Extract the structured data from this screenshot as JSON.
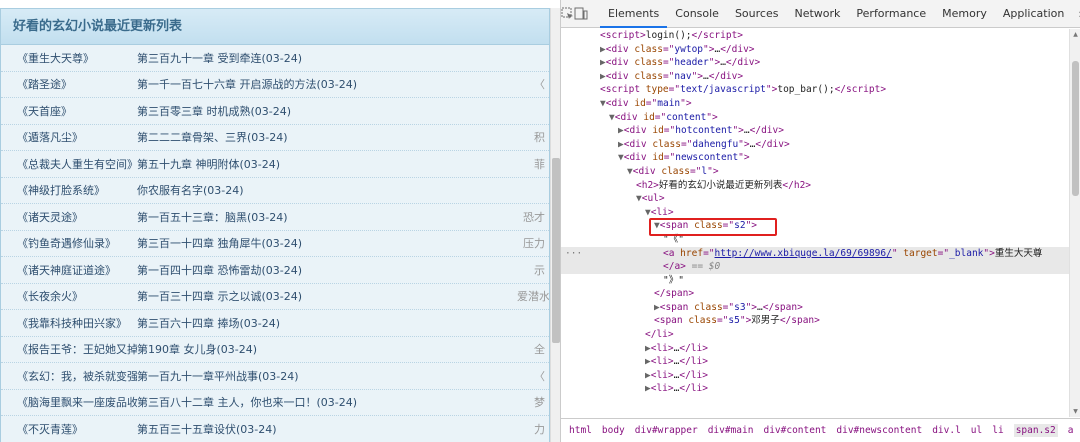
{
  "page": {
    "heading": "好看的玄幻小说最近更新列表",
    "rows": [
      {
        "title": "《重生大天尊》",
        "chapter": "第三百九十一章 受到牵连(03-24)",
        "author": ""
      },
      {
        "title": "《踏圣途》",
        "chapter": "第一千一百七十六章 开启源战的方法(03-24)",
        "author": "〈"
      },
      {
        "title": "《天首座》",
        "chapter": "第三百零三章 时机成熟(03-24)",
        "author": ""
      },
      {
        "title": "《遁落凡尘》",
        "chapter": "第二二二章骨架、三界(03-24)",
        "author": "积"
      },
      {
        "title": "《总裁夫人重生有空间》",
        "chapter": "第五十九章 神明附体(03-24)",
        "author": "菲"
      },
      {
        "title": "《神级打脸系统》",
        "chapter": "你农服有名字(03-24)",
        "author": ""
      },
      {
        "title": "《诸天灵途》",
        "chapter": "第一百五十三章：脑黑(03-24)",
        "author": "恐才"
      },
      {
        "title": "《钓鱼奇遇修仙录》",
        "chapter": "第三百一十四章 独角犀牛(03-24)",
        "author": "压力"
      },
      {
        "title": "《诸天神庭证道途》",
        "chapter": "第一百四十四章 恐怖雷劫(03-24)",
        "author": "示"
      },
      {
        "title": "《长夜余火》",
        "chapter": "第一百三十四章 示之以诚(03-24)",
        "author": "爱潜水"
      },
      {
        "title": "《我靠科技种田兴家》",
        "chapter": "第三百六十四章 捧场(03-24)",
        "author": ""
      },
      {
        "title": "《报告王爷：王妃她又掉马",
        "chapter": "第190章 女儿身(03-24)",
        "author": "全"
      },
      {
        "title": "《玄幻：我，被杀就变强！》",
        "chapter": "第一百九十一章平州战事(03-24)",
        "author": "〈"
      },
      {
        "title": "《脑海里飘来一座废品收购",
        "chapter": "第三百八十二章 主人，你也来一口！(03-24)",
        "author": "梦"
      },
      {
        "title": "《不灭青莲》",
        "chapter": "第五百三十五章设伏(03-24)",
        "author": "力"
      }
    ]
  },
  "devtools": {
    "tabs": [
      "Elements",
      "Console",
      "Sources",
      "Network",
      "Performance",
      "Memory",
      "Application"
    ],
    "more": "»",
    "lines": [
      {
        "indent": 1,
        "html": "<span class='tag'>&lt;script&gt;</span><span class='txt'>login();</span><span class='tag'>&lt;/script&gt;</span>"
      },
      {
        "indent": 1,
        "html": "<span class='tri'>▶</span><span class='tag'>&lt;div </span><span class='attr'>class</span><span class='tag'>=\"</span><span class='val'>ywtop</span><span class='tag'>\"&gt;</span><span class='txt'>…</span><span class='tag'>&lt;/div&gt;</span>"
      },
      {
        "indent": 1,
        "html": "<span class='tri'>▶</span><span class='tag'>&lt;div </span><span class='attr'>class</span><span class='tag'>=\"</span><span class='val'>header</span><span class='tag'>\"&gt;</span><span class='txt'>…</span><span class='tag'>&lt;/div&gt;</span>"
      },
      {
        "indent": 1,
        "html": "<span class='tri'>▶</span><span class='tag'>&lt;div </span><span class='attr'>class</span><span class='tag'>=\"</span><span class='val'>nav</span><span class='tag'>\"&gt;</span><span class='txt'>…</span><span class='tag'>&lt;/div&gt;</span>"
      },
      {
        "indent": 1,
        "html": "<span class='tag'>&lt;script </span><span class='attr'>type</span><span class='tag'>=\"</span><span class='val'>text/javascript</span><span class='tag'>\"&gt;</span><span class='txt'>top_bar();</span><span class='tag'>&lt;/script&gt;</span>"
      },
      {
        "indent": 1,
        "html": "<span class='tri'>▼</span><span class='tag'>&lt;div </span><span class='attr'>id</span><span class='tag'>=\"</span><span class='val'>main</span><span class='tag'>\"&gt;</span>"
      },
      {
        "indent": 2,
        "html": "<span class='tri'>▼</span><span class='tag'>&lt;div </span><span class='attr'>id</span><span class='tag'>=\"</span><span class='val'>content</span><span class='tag'>\"&gt;</span>"
      },
      {
        "indent": 3,
        "html": "<span class='tri'>▶</span><span class='tag'>&lt;div </span><span class='attr'>id</span><span class='tag'>=\"</span><span class='val'>hotcontent</span><span class='tag'>\"&gt;</span><span class='txt'>…</span><span class='tag'>&lt;/div&gt;</span>"
      },
      {
        "indent": 3,
        "html": "<span class='tri'>▶</span><span class='tag'>&lt;div </span><span class='attr'>class</span><span class='tag'>=\"</span><span class='val'>dahengfu</span><span class='tag'>\"&gt;</span><span class='txt'>…</span><span class='tag'>&lt;/div&gt;</span>"
      },
      {
        "indent": 3,
        "html": "<span class='tri'>▼</span><span class='tag'>&lt;div </span><span class='attr'>id</span><span class='tag'>=\"</span><span class='val'>newscontent</span><span class='tag'>\"&gt;</span>"
      },
      {
        "indent": 4,
        "html": "<span class='tri'>▼</span><span class='tag'>&lt;div </span><span class='attr'>class</span><span class='tag'>=\"</span><span class='val'>l</span><span class='tag'>\"&gt;</span>"
      },
      {
        "indent": 5,
        "html": "<span class='tag'>&lt;h2&gt;</span><span class='txt'>好看的玄幻小说最近更新列表</span><span class='tag'>&lt;/h2&gt;</span>"
      },
      {
        "indent": 5,
        "html": "<span class='tri'>▼</span><span class='tag'>&lt;ul&gt;</span>"
      },
      {
        "indent": 6,
        "html": "<span class='tri'>▼</span><span class='tag'>&lt;li&gt;</span>"
      },
      {
        "indent": 7,
        "html": "<span class='tri'>▼</span><span class='tag'>&lt;span </span><span class='attr'>class</span><span class='tag'>=\"</span><span class='val'>s2</span><span class='tag'>\"&gt;</span>"
      },
      {
        "indent": 8,
        "html": "<span class='txt'>\"《\"</span>"
      },
      {
        "indent": 8,
        "selected": true,
        "html": "<span class='tag'>&lt;a </span><span class='attr'>href</span><span class='tag'>=\"</span><span class='link'>http://www.xbiquge.la/69/69896/</span><span class='tag'>\" </span><span class='attr'>target</span><span class='tag'>=\"</span><span class='val'>_blank</span><span class='tag'>\"&gt;</span><span class='txt'>重生大天尊</span>"
      },
      {
        "indent": 8,
        "selected": true,
        "html": "<span class='tag'>&lt;/a&gt;</span><span class='cm'> == $0</span>"
      },
      {
        "indent": 8,
        "html": "<span class='txt'>\"》\"</span>"
      },
      {
        "indent": 7,
        "html": "<span class='tag'>&lt;/span&gt;</span>"
      },
      {
        "indent": 7,
        "html": "<span class='tri'>▶</span><span class='tag'>&lt;span </span><span class='attr'>class</span><span class='tag'>=\"</span><span class='val'>s3</span><span class='tag'>\"&gt;</span><span class='txt'>…</span><span class='tag'>&lt;/span&gt;</span>"
      },
      {
        "indent": 7,
        "html": "<span class='tag'>&lt;span </span><span class='attr'>class</span><span class='tag'>=\"</span><span class='val'>s5</span><span class='tag'>\"&gt;</span><span class='txt'>邓男子</span><span class='tag'>&lt;/span&gt;</span>"
      },
      {
        "indent": 6,
        "html": "<span class='tag'>&lt;/li&gt;</span>"
      },
      {
        "indent": 6,
        "html": "<span class='tri'>▶</span><span class='tag'>&lt;li&gt;</span><span class='txt'>…</span><span class='tag'>&lt;/li&gt;</span>"
      },
      {
        "indent": 6,
        "html": "<span class='tri'>▶</span><span class='tag'>&lt;li&gt;</span><span class='txt'>…</span><span class='tag'>&lt;/li&gt;</span>"
      },
      {
        "indent": 6,
        "html": "<span class='tri'>▶</span><span class='tag'>&lt;li&gt;</span><span class='txt'>…</span><span class='tag'>&lt;/li&gt;</span>"
      },
      {
        "indent": 6,
        "html": "<span class='tri'>▶</span><span class='tag'>&lt;li&gt;</span><span class='txt'>…</span><span class='tag'>&lt;/li&gt;</span>"
      }
    ],
    "selected_marker": "···",
    "breadcrumbs": [
      "html",
      "body",
      "div#wrapper",
      "div#main",
      "div#content",
      "div#newscontent",
      "div.l",
      "ul",
      "li",
      "span.s2",
      "a"
    ]
  },
  "colors": {
    "heading_bg": "#c8e2f1",
    "list_bg": "#eaf3f8",
    "tag": "#881280",
    "attr": "#994500",
    "value": "#1a1aa6",
    "highlight_box": "#e0201f",
    "active_tab": "#1a73e8"
  }
}
